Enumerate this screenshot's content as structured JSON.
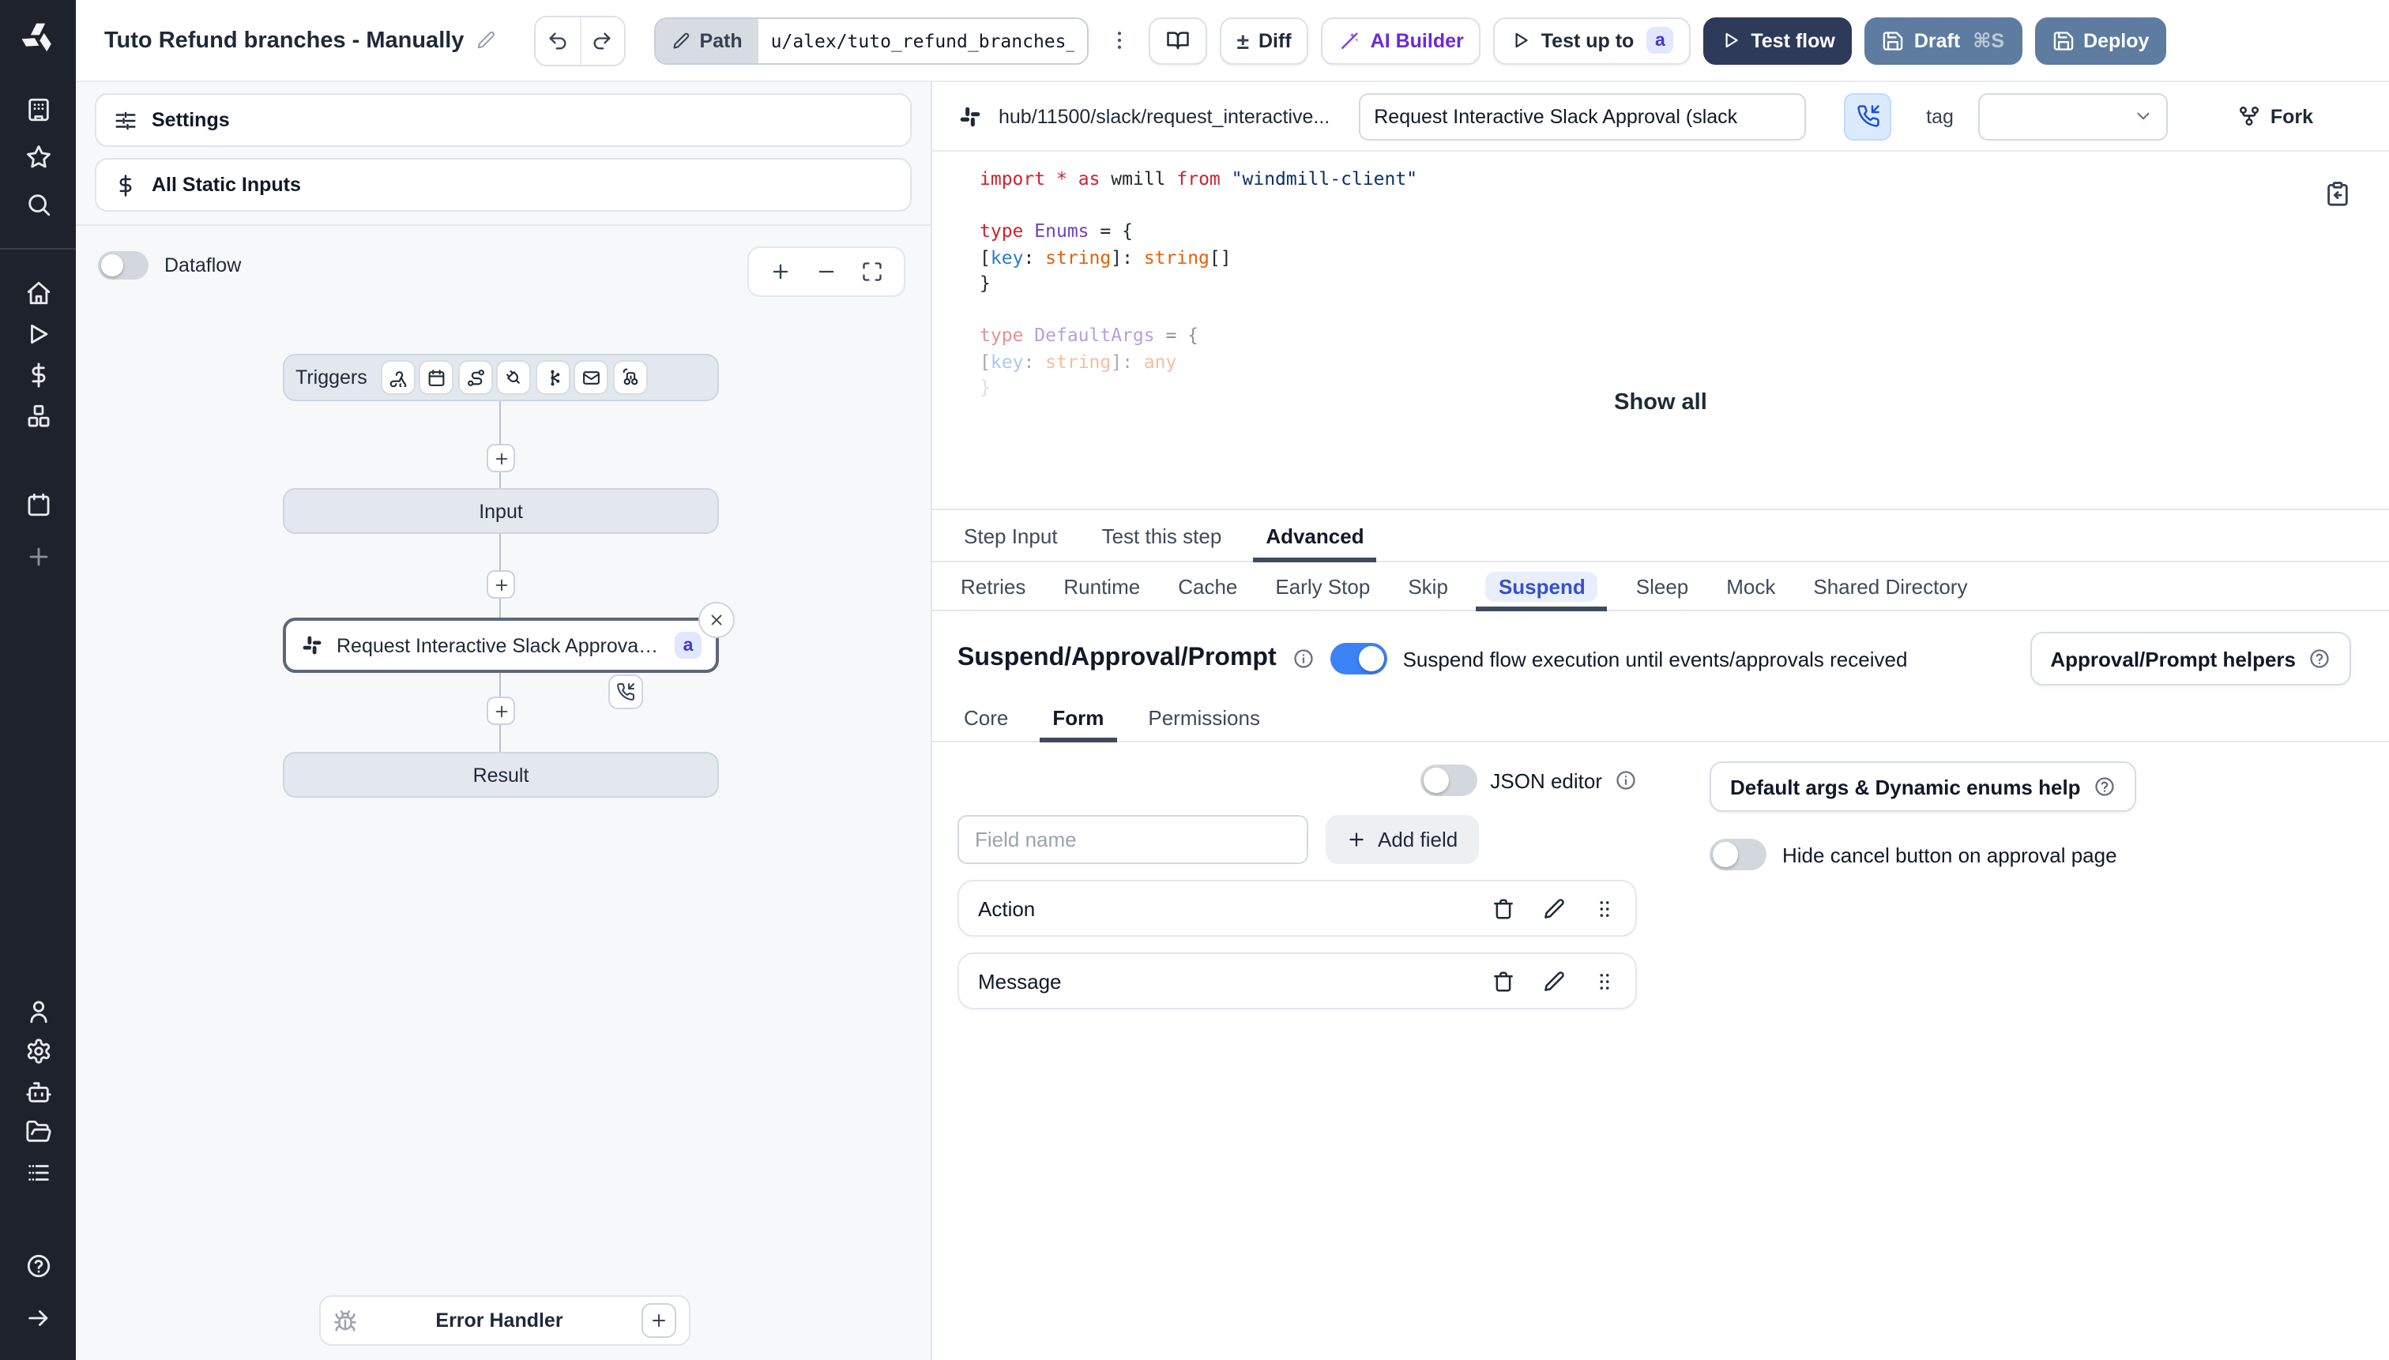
{
  "topbar": {
    "title": "Tuto Refund branches - Manually",
    "path_label": "Path",
    "path_value": "u/alex/tuto_refund_branches__",
    "diff_label": "Diff",
    "ai_builder_label": "AI Builder",
    "test_up_to_label": "Test up to",
    "test_up_to_badge": "a",
    "test_flow_label": "Test flow",
    "draft_label": "Draft",
    "draft_shortcut": "⌘S",
    "deploy_label": "Deploy"
  },
  "sidebar": {
    "top_icons": [
      "building",
      "star",
      "search"
    ],
    "mid_icons": [
      "home",
      "play",
      "dollar",
      "boxes"
    ],
    "workspace_icons": [
      "calendar",
      "plus"
    ],
    "bottom_icons": [
      "user",
      "gear",
      "robot",
      "folder",
      "list"
    ],
    "footer_icons": [
      "help",
      "arrow-right"
    ]
  },
  "flow": {
    "settings_label": "Settings",
    "static_inputs_label": "All Static Inputs",
    "dataflow_label": "Dataflow",
    "triggers_label": "Triggers",
    "trigger_icons": [
      "webhook",
      "schedule",
      "route",
      "plug",
      "kafka",
      "mail",
      "poll"
    ],
    "input_node": "Input",
    "step_node": "Request Interactive Slack Approval (...",
    "step_badge": "a",
    "result_node": "Result",
    "error_handler": "Error Handler"
  },
  "script_header": {
    "hub_path": "hub/11500/slack/request_interactive...",
    "name_value": "Request Interactive Slack Approval (slack",
    "tag_label": "tag",
    "fork_label": "Fork"
  },
  "code": {
    "show_all_label": "Show all",
    "lines": [
      {
        "o": 1,
        "t": [
          [
            "k",
            "import"
          ],
          [
            "p",
            " "
          ],
          [
            "k",
            "*"
          ],
          [
            "p",
            " "
          ],
          [
            "k",
            "as"
          ],
          [
            "p",
            " wmill "
          ],
          [
            "k",
            "from"
          ],
          [
            "p",
            " "
          ],
          [
            "s",
            "\"windmill-client\""
          ]
        ]
      },
      {
        "o": 1,
        "t": []
      },
      {
        "o": 1,
        "t": [
          [
            "k",
            "type"
          ],
          [
            "p",
            " "
          ],
          [
            "y",
            "Enums"
          ],
          [
            "p",
            " = {"
          ]
        ]
      },
      {
        "o": 1,
        "t": [
          [
            "p",
            "  ["
          ],
          [
            "v",
            "key"
          ],
          [
            "p",
            ": "
          ],
          [
            "g",
            "string"
          ],
          [
            "p",
            "]: "
          ],
          [
            "g",
            "string"
          ],
          [
            "p",
            "[]"
          ]
        ]
      },
      {
        "o": 1,
        "t": [
          [
            "p",
            "}"
          ]
        ]
      },
      {
        "o": 1,
        "t": []
      },
      {
        "o": 0.5,
        "t": [
          [
            "k",
            "type"
          ],
          [
            "p",
            " "
          ],
          [
            "y",
            "DefaultArgs"
          ],
          [
            "p",
            " = {"
          ]
        ]
      },
      {
        "o": 0.4,
        "t": [
          [
            "p",
            "  ["
          ],
          [
            "v",
            "key"
          ],
          [
            "p",
            ": "
          ],
          [
            "g",
            "string"
          ],
          [
            "p",
            "]: "
          ],
          [
            "g",
            "any"
          ]
        ]
      },
      {
        "o": 0.15,
        "t": [
          [
            "p",
            "}"
          ]
        ]
      }
    ]
  },
  "tabs": {
    "items": [
      "Step Input",
      "Test this step",
      "Advanced"
    ],
    "active": "Advanced"
  },
  "subtabs": {
    "items": [
      "Retries",
      "Runtime",
      "Cache",
      "Early Stop",
      "Skip",
      "Suspend",
      "Sleep",
      "Mock",
      "Shared Directory"
    ],
    "active": "Suspend"
  },
  "suspend": {
    "title": "Suspend/Approval/Prompt",
    "description": "Suspend flow execution until events/approvals received",
    "toggle_on": true,
    "helpers_button": "Approval/Prompt helpers",
    "form_tabs": {
      "items": [
        "Core",
        "Form",
        "Permissions"
      ],
      "active": "Form"
    },
    "json_editor_label": "JSON editor",
    "field_placeholder": "Field name",
    "add_field_label": "Add field",
    "fields": [
      "Action",
      "Message"
    ],
    "default_args_button": "Default args & Dynamic enums help",
    "hide_cancel_label": "Hide cancel button on approval page"
  },
  "colors": {
    "accent_blue": "#3b82f6",
    "indigo_badge": "#4338ca",
    "navy_button": "#2e3a5a",
    "steel_button": "#5e7ca0",
    "ai_purple": "#6d28d9",
    "sidebar_bg": "#1e222c"
  }
}
